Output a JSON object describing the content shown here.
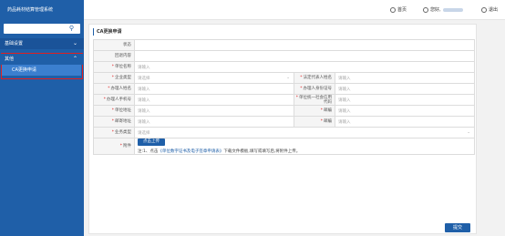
{
  "app": {
    "title": "药品耗材结算管理系统"
  },
  "sidebar": {
    "search_icon": "search-icon",
    "groups": [
      {
        "label": "基础设置"
      },
      {
        "label": "其他",
        "items": [
          {
            "label": "CA更换申请"
          }
        ]
      }
    ]
  },
  "header": {
    "home_label": "首页",
    "greeting": "您好,",
    "logout_label": "退出"
  },
  "page": {
    "title": "CA更换申请",
    "fields": {
      "status_label": "状态",
      "reject_label": "回退内容",
      "unit_name_label": "单位名称",
      "unit_name_ph": "请输入",
      "company_type_label": "企业类型",
      "company_type_ph": "请选择",
      "legal_label": "法定代表人姓名",
      "legal_ph": "请输入",
      "handler_name_label": "办理人姓名",
      "handler_name_ph": "请输入",
      "handler_id_label": "办理人身份证号",
      "handler_id_ph": "请输入",
      "handler_phone_label": "办理人手机号",
      "handler_phone_ph": "请输入",
      "credit_code_label": "单位统一社会信用代码",
      "credit_code_ph": "请输入",
      "unit_addr_label": "单位地址",
      "unit_addr_ph": "请输入",
      "zip1_label": "邮编",
      "zip1_ph": "请输入",
      "mail_addr_label": "邮寄地址",
      "mail_addr_ph": "请输入",
      "zip2_label": "邮编",
      "zip2_ph": "请输入",
      "business_type_label": "业务类型",
      "business_type_ph": "请选择",
      "attachment_label": "附件",
      "upload_label": "点击上传",
      "note_prefix": "注:1、点击",
      "note_link": "《单位数字证书及电子签章申请表》",
      "note_suffix": "下载文件模板,填写或填写后,将附件上传。"
    },
    "submit_label": "提交"
  },
  "colors": {
    "brand": "#1f5fa8",
    "highlight": "#e02020"
  }
}
